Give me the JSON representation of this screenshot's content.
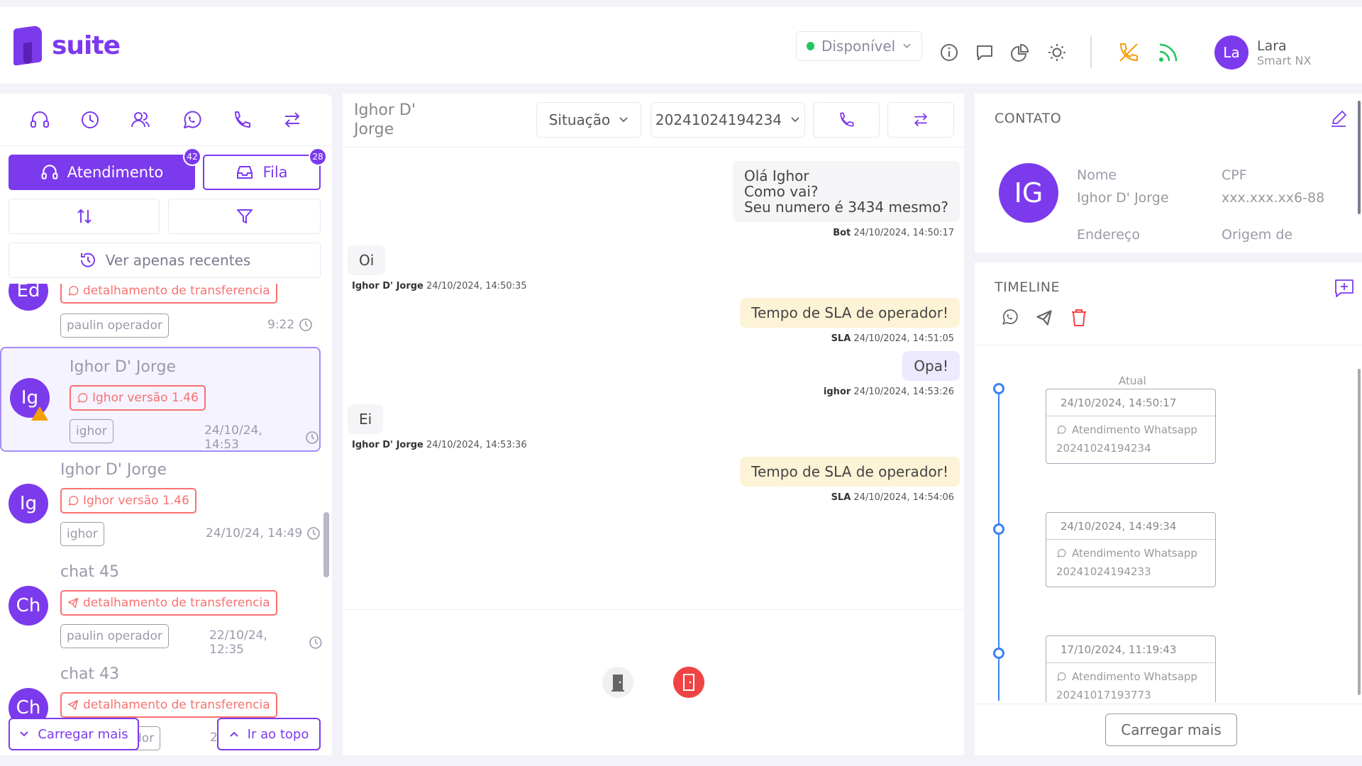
{
  "brand": {
    "logo_text": "suite",
    "accent": "#7c3aed"
  },
  "header": {
    "status_label": "Disponível",
    "status_color": "#22c55e",
    "icons": [
      "info-icon",
      "chat-icon",
      "pie-chart-icon",
      "sun-icon",
      "phone-off-icon",
      "rss-icon"
    ],
    "user": {
      "initials": "La",
      "name": "Lara",
      "company": "Smart NX"
    }
  },
  "left": {
    "tabs": [
      "headset-icon",
      "clock-icon",
      "users-icon",
      "whatsapp-icon",
      "phone-icon",
      "transfer-icon"
    ],
    "atendimento_label": "Atendimento",
    "atendimento_count": "42",
    "fila_label": "Fila",
    "fila_count": "28",
    "recent_label": "Ver apenas recentes",
    "chats": [
      {
        "initials": "Ed",
        "name": "",
        "tag": "detalhamento de transferencia",
        "tag_icon": "whatsapp-icon",
        "operator": "paulin operador",
        "time": "9:22"
      },
      {
        "initials": "Ig",
        "name": "Ighor D' Jorge",
        "tag": "Ighor versão 1.46",
        "tag_icon": "whatsapp-icon",
        "operator": "ighor",
        "time": "24/10/24, 14:53",
        "active": true,
        "warning": true
      },
      {
        "initials": "Ig",
        "name": "Ighor D' Jorge",
        "tag": "Ighor versão 1.46",
        "tag_icon": "whatsapp-icon",
        "operator": "ighor",
        "time": "24/10/24, 14:49"
      },
      {
        "initials": "Ch",
        "name": "chat 45",
        "tag": "detalhamento de transferencia",
        "tag_icon": "telegram-icon",
        "operator": "paulin operador",
        "time": "22/10/24, 12:35"
      },
      {
        "initials": "Ch",
        "name": "chat 43",
        "tag": "detalhamento de transferencia",
        "tag_icon": "telegram-icon",
        "operator": "dor",
        "time": "2"
      }
    ],
    "load_more_label": "Carregar mais",
    "go_top_label": "Ir ao topo"
  },
  "middle": {
    "title": "Ighor D' Jorge",
    "situacao_label": "Situação",
    "protocol": "20241024194234",
    "messages": [
      {
        "type": "bot",
        "text": "Olá Ighor\nComo vai?\nSeu numero é 3434 mesmo?",
        "author": "Bot",
        "time": "24/10/2024, 14:50:17"
      },
      {
        "type": "client",
        "text": "Oi",
        "author": "Ighor D' Jorge",
        "time": "24/10/2024, 14:50:35"
      },
      {
        "type": "sla",
        "text": "Tempo de SLA de operador!",
        "author": "SLA",
        "time": "24/10/2024, 14:51:05"
      },
      {
        "type": "op",
        "text": "Opa!",
        "author": "ighor",
        "time": "24/10/2024, 14:53:26"
      },
      {
        "type": "client",
        "text": "Ei",
        "author": "Ighor D' Jorge",
        "time": "24/10/2024, 14:53:36"
      },
      {
        "type": "sla",
        "text": "Tempo de SLA de operador!",
        "author": "SLA",
        "time": "24/10/2024, 14:54:06"
      }
    ]
  },
  "contact": {
    "section_title": "CONTATO",
    "initials": "IG",
    "nome_label": "Nome",
    "nome_value": "Ighor D' Jorge",
    "cpf_label": "CPF",
    "cpf_value": "xxx.xxx.xx6-88",
    "endereco_label": "Endereço",
    "origem_label": "Origem de"
  },
  "timeline": {
    "section_title": "TIMELINE",
    "current_label": "Atual",
    "entries": [
      {
        "date": "24/10/2024,  14:50:17",
        "channel": "Atendimento Whatsapp",
        "protocol": "20241024194234"
      },
      {
        "date": "24/10/2024,  14:49:34",
        "channel": "Atendimento Whatsapp",
        "protocol": "20241024194233"
      },
      {
        "date": "17/10/2024,  11:19:43",
        "channel": "Atendimento Whatsapp",
        "protocol": "20241017193773"
      }
    ],
    "load_more_label": "Carregar mais"
  }
}
